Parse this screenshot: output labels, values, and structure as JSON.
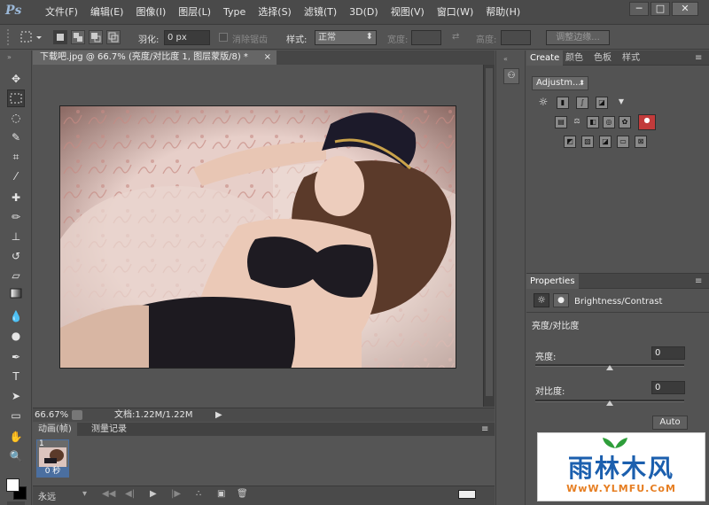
{
  "app": {
    "logo": "Ps"
  },
  "menu": [
    "文件(F)",
    "编辑(E)",
    "图像(I)",
    "图层(L)",
    "Type",
    "选择(S)",
    "滤镜(T)",
    "3D(D)",
    "视图(V)",
    "窗口(W)",
    "帮助(H)"
  ],
  "window_controls": [
    "─",
    "□",
    "✕"
  ],
  "options_bar": {
    "feather_label": "羽化:",
    "feather_value": "0 px",
    "anti_alias_label": "消除锯齿",
    "style_label": "样式:",
    "style_value": "正常",
    "width_label": "宽度:",
    "height_label": "高度:",
    "refine_edge_label": "调整边缘..."
  },
  "document": {
    "tab_title": "下载吧.jpg @ 66.7% (亮度/对比度 1, 图层蒙版/8) *",
    "tab_close": "×",
    "zoom": "66.67%",
    "doc_info": "文档:1.22M/1.22M"
  },
  "animation_panel": {
    "tabs": [
      "动画(帧)",
      "测量记录"
    ],
    "frame_number": "1",
    "frame_delay": "0 秒",
    "loop_value": "永远"
  },
  "adjustments_panel": {
    "tabs": [
      "Create",
      "颜色",
      "色板",
      "样式"
    ],
    "preset_select": "Adjustm..."
  },
  "properties_panel": {
    "tab": "Properties",
    "type_title": "Brightness/Contrast",
    "section_title": "亮度/对比度",
    "brightness_label": "亮度:",
    "brightness_value": "0",
    "brightness_level": 0.5,
    "contrast_label": "对比度:",
    "contrast_value": "0",
    "contrast_level": 0.5,
    "auto_button": "Auto"
  },
  "watermark": {
    "brand": "雨林木风",
    "url": "WwW.YLMFU.CoM"
  },
  "colors": {
    "accent": "#4b6fa0",
    "panel": "#535353"
  }
}
